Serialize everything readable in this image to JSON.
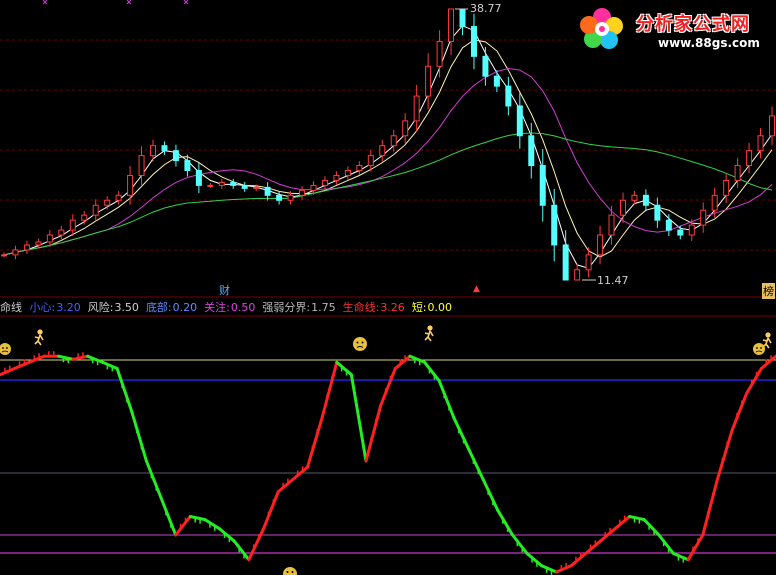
{
  "colors": {
    "background": "#000000",
    "bull_candle": "#ff3b3b",
    "bear_candle": "#54ffff",
    "ma_short": "#ffffff",
    "ma_mid": "#fff6b0",
    "ma_purple": "#d23cd2",
    "ma_long": "#33d24a",
    "indicator_up": "#ff2020",
    "indicator_down": "#22ee22",
    "ref_yellow": "#d8d870",
    "ref_blue": "#2b2bff",
    "ref_magenta": "#cc33cc",
    "grid_red": "#7a0000"
  },
  "logo": {
    "icon": "flower-logo-icon",
    "title": "分析家公式网",
    "url": "www.88gs.com"
  },
  "price_chart": {
    "high_label": "38.77",
    "low_label": "11.47",
    "markers": {
      "cai": "财",
      "up_arrow": "▲",
      "right_marker": "榜"
    }
  },
  "indicator_header": {
    "title": "命线",
    "items": [
      {
        "label": "小心:",
        "value": "3.20",
        "color": "#3d63ff"
      },
      {
        "label": "风险:",
        "value": "3.50",
        "color": "#cfcfcf"
      },
      {
        "label": "底部:",
        "value": "0.20",
        "color": "#5f8bff"
      },
      {
        "label": "关注:",
        "value": "0.50",
        "color": "#e040e0"
      },
      {
        "label": "强弱分界:",
        "value": "1.75",
        "color": "#b8b8b8"
      },
      {
        "label": "生命线:",
        "value": "3.26",
        "color": "#ff3030"
      },
      {
        "label": "短:",
        "value": "0.00",
        "color": "#ffff40"
      }
    ]
  },
  "chart_data": [
    {
      "type": "candlestick",
      "title": "",
      "annotations": [
        "38.77",
        "11.47"
      ],
      "ylim": [
        11.47,
        38.77
      ],
      "series": [
        {
          "values": [
            14,
            14.5,
            15,
            15.3,
            16,
            16.5,
            17.5,
            18,
            19,
            19.5,
            20,
            22,
            24,
            25,
            24.5,
            23.5,
            22.5,
            21,
            21,
            21.3,
            21,
            20.7,
            20.8,
            20,
            19.5,
            20,
            20.5,
            21,
            21.5,
            22,
            22.5,
            23,
            24,
            25,
            26,
            27.5,
            30,
            33,
            35.5,
            38.77,
            37,
            34,
            32,
            31,
            29,
            26,
            23,
            19,
            15,
            11.47,
            12.5,
            14,
            16,
            18,
            19.5,
            20,
            19,
            17.5,
            16.5,
            16,
            17,
            18.5,
            20,
            21.5,
            23,
            24.5,
            26,
            28
          ]
        }
      ]
    },
    {
      "type": "line",
      "title": "",
      "series": [
        {
          "name": "生命线",
          "values": [
            3.2,
            3.3,
            3.4,
            3.5,
            3.5,
            3.45,
            3.5,
            3.4,
            3.3,
            2.6,
            1.8,
            1.2,
            0.6,
            0.9,
            0.85,
            0.7,
            0.5,
            0.2,
            0.7,
            1.3,
            1.5,
            1.7,
            2.5,
            3.4,
            3.2,
            1.8,
            2.7,
            3.3,
            3.5,
            3.4,
            3.1,
            2.5,
            2.0,
            1.5,
            1.0,
            0.6,
            0.3,
            0.1,
            0.0,
            0.1,
            0.3,
            0.5,
            0.7,
            0.9,
            0.85,
            0.6,
            0.3,
            0.2,
            0.6,
            1.5,
            2.3,
            2.9,
            3.3,
            3.5
          ]
        }
      ],
      "reference_lines": [
        3.5,
        3.2,
        1.75,
        0.5,
        0.2
      ],
      "ylim": [
        0,
        3.6
      ]
    }
  ]
}
